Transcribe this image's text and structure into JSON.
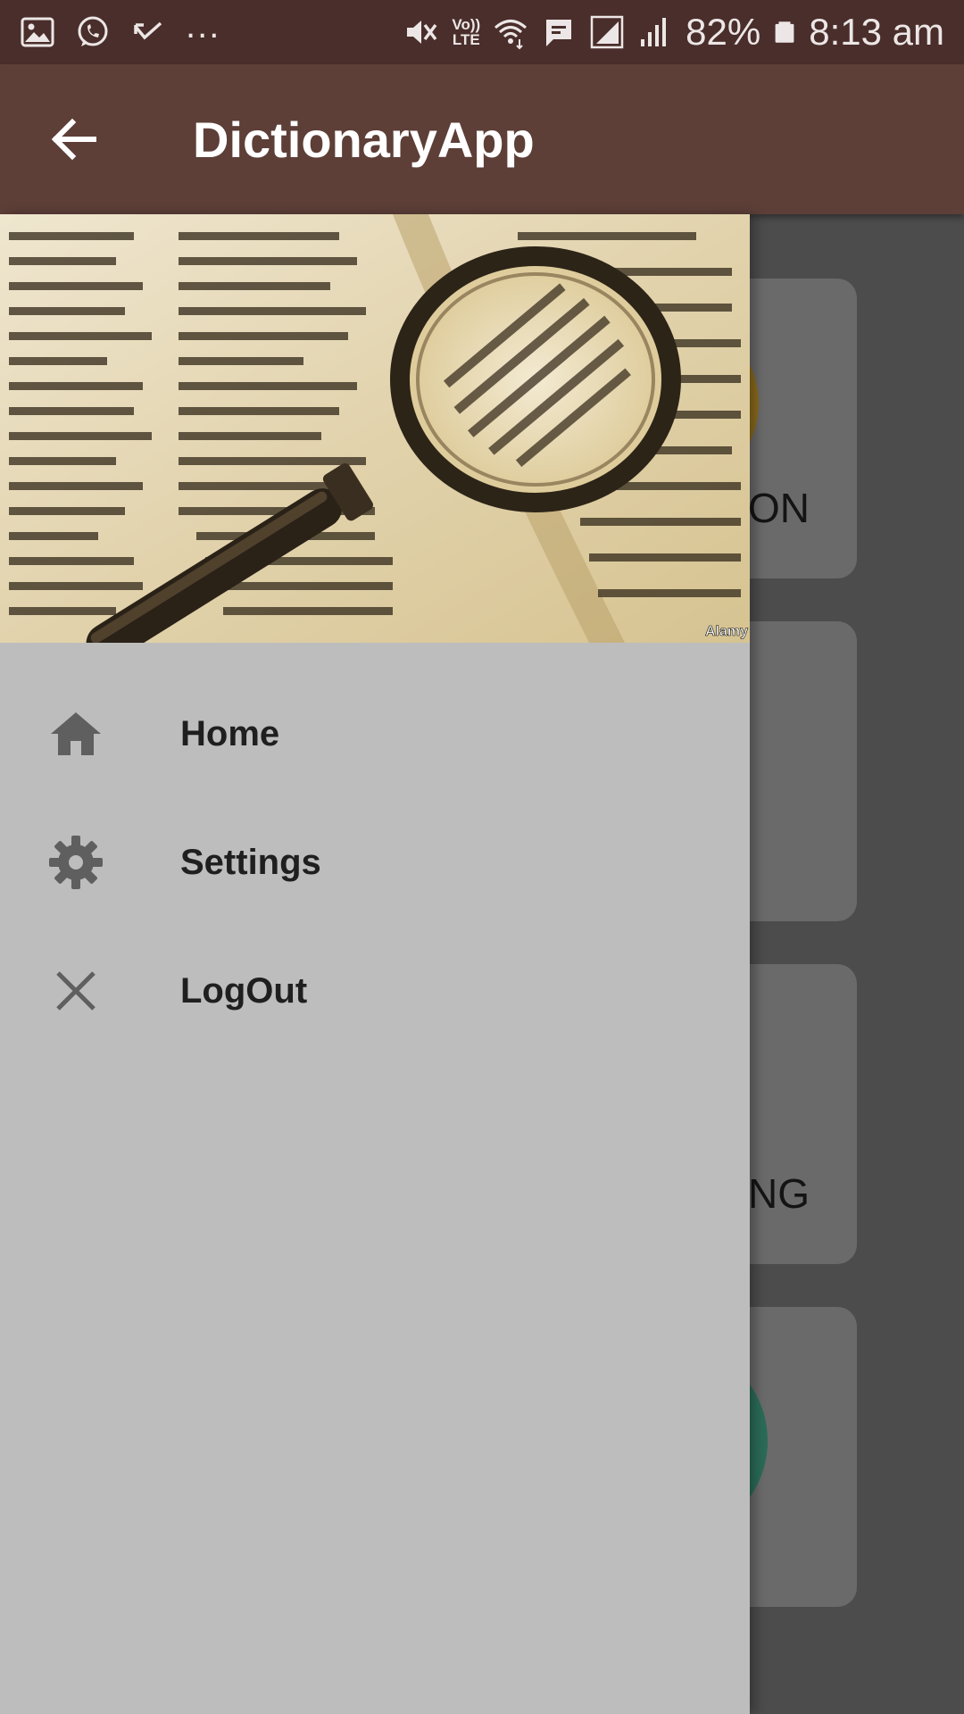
{
  "status_bar": {
    "network_label": "Vo))\nLTE",
    "battery_percent": "82%",
    "time": "8:13 am",
    "more_indicator": "...",
    "icons": [
      "gallery-icon",
      "whatsapp-icon",
      "missed-call-icon",
      "mute-icon",
      "volte-icon",
      "wifi-icon",
      "message-icon",
      "signal-icon",
      "signal-icon",
      "battery-icon"
    ]
  },
  "app_bar": {
    "title": "DictionaryApp",
    "back_icon": "arrow-left-icon"
  },
  "drawer": {
    "header_image": {
      "watermark": "Alamy"
    },
    "items": [
      {
        "label": "Home",
        "icon": "home-icon"
      },
      {
        "label": "Settings",
        "icon": "gear-icon"
      },
      {
        "label": "LogOut",
        "icon": "close-icon"
      }
    ]
  },
  "background_cards": [
    {
      "label": "ON"
    },
    {
      "label": ""
    },
    {
      "label": "NG"
    },
    {
      "label": ""
    }
  ],
  "colors": {
    "status_bar": "#4a2e2b",
    "app_bar": "#5d3f38",
    "drawer_background": "#bdbdbd",
    "scrim": "#4c4c4c"
  }
}
